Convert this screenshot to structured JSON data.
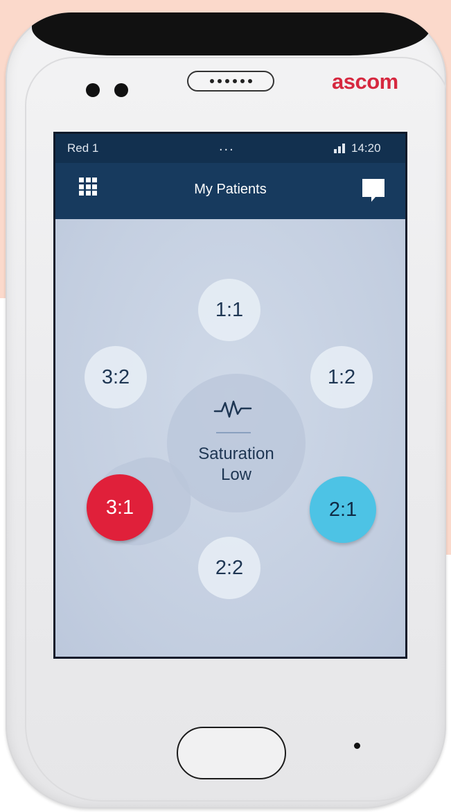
{
  "device": {
    "brand": "ascom",
    "brand_color": "#d6283f"
  },
  "status_bar": {
    "carrier": "Red 1",
    "dots": "...",
    "time": "14:20",
    "signal_icon": "signal-bars-icon"
  },
  "app_bar": {
    "title": "My Patients",
    "left_icon": "grid-menu-icon",
    "right_icon": "chat-bubble-icon"
  },
  "patients": {
    "p1_1": "1:1",
    "p1_2": "1:2",
    "p2_1": "2:1",
    "p2_2": "2:2",
    "p3_1": "3:1",
    "p3_2": "3:2"
  },
  "alert": {
    "icon": "heartbeat-icon",
    "line1": "Saturation",
    "line2": "Low"
  },
  "colors": {
    "alarm_red": "#e0203a",
    "info_cyan": "#4dc3e5",
    "header_navy": "#173a5e"
  }
}
